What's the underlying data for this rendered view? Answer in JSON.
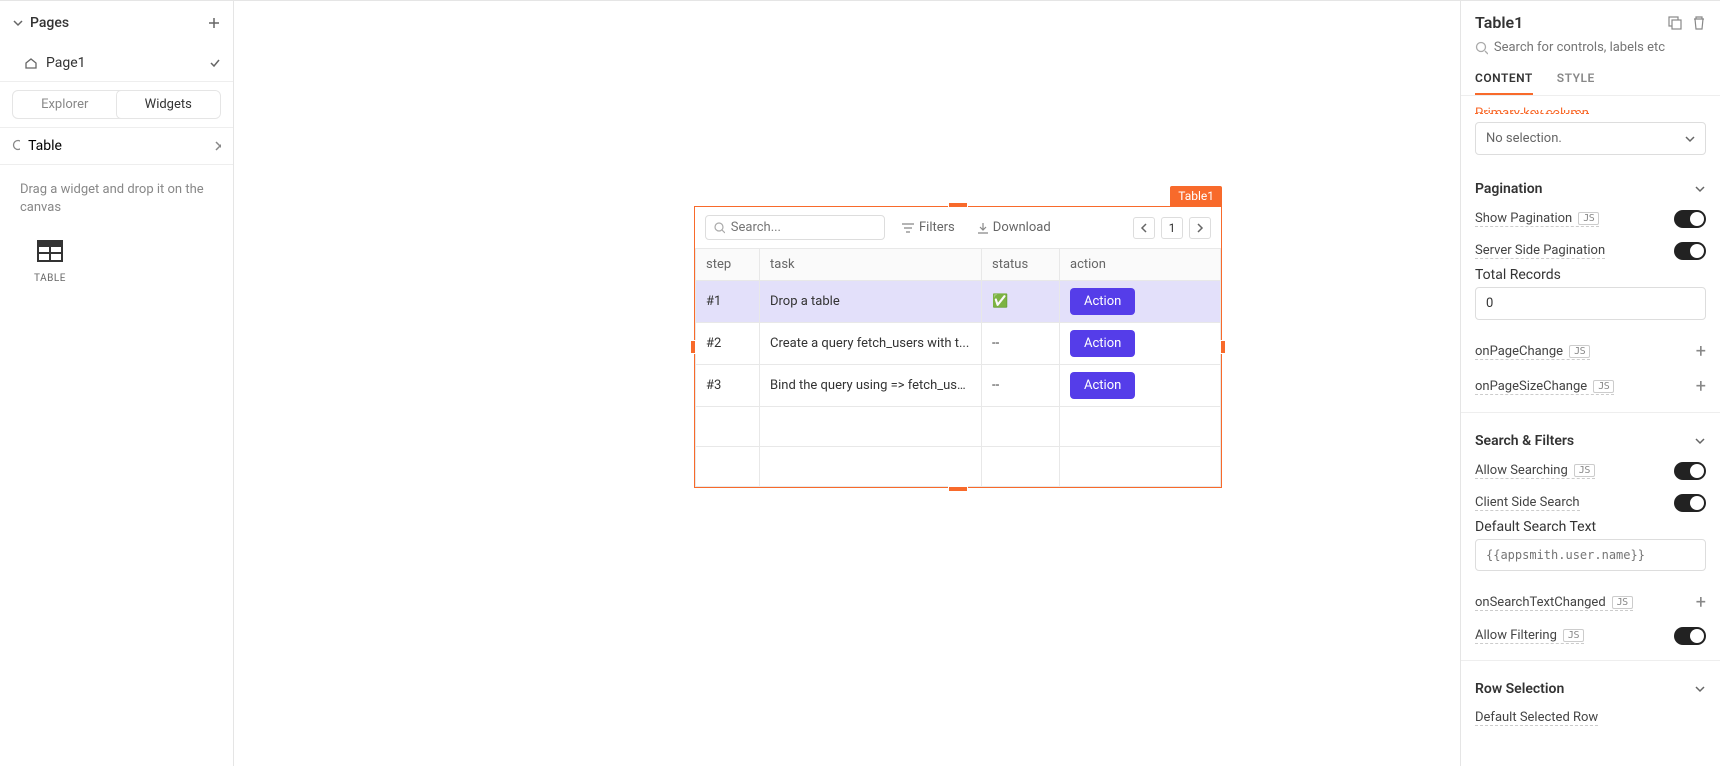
{
  "leftPanel": {
    "pagesLabel": "Pages",
    "pages": [
      "Page1"
    ],
    "segments": {
      "explorer": "Explorer",
      "widgets": "Widgets"
    },
    "searchValue": "Table",
    "hint": "Drag a widget and drop it on the canvas",
    "widgetTile": "TABLE"
  },
  "canvas": {
    "widgetName": "Table1",
    "toolbar": {
      "searchPlaceholder": "Search...",
      "filters": "Filters",
      "download": "Download",
      "page": "1"
    },
    "columns": [
      "step",
      "task",
      "status",
      "action"
    ],
    "colWidths": [
      "64px",
      "222px",
      "78px",
      "auto"
    ],
    "actionLabel": "Action",
    "emptyRows": 2,
    "rows": [
      {
        "step": "#1",
        "task": "Drop a table",
        "status": "✅",
        "selected": true
      },
      {
        "step": "#2",
        "task": "Create a query fetch_users with t...",
        "status": "--",
        "selected": false
      },
      {
        "step": "#3",
        "task": "Bind the query using => fetch_use...",
        "status": "--",
        "selected": false
      }
    ]
  },
  "rightPanel": {
    "title": "Table1",
    "searchPlaceholder": "Search for controls, labels etc",
    "tabs": {
      "content": "CONTENT",
      "style": "STYLE"
    },
    "primaryKeyCut": "Primary key column",
    "primaryKeyValue": "No selection.",
    "sections": {
      "pagination": {
        "title": "Pagination",
        "showPagination": "Show Pagination",
        "serverSide": "Server Side Pagination",
        "totalRecordsLabel": "Total Records",
        "totalRecordsValue": "0",
        "onPageChange": "onPageChange",
        "onPageSizeChange": "onPageSizeChange"
      },
      "searchFilters": {
        "title": "Search & Filters",
        "allowSearching": "Allow Searching",
        "clientSideSearch": "Client Side Search",
        "defaultSearchLabel": "Default Search Text",
        "defaultSearchPlaceholder": "{{appsmith.user.name}}",
        "onSearchTextChanged": "onSearchTextChanged",
        "allowFiltering": "Allow Filtering"
      },
      "rowSelection": {
        "title": "Row Selection",
        "defaultSelectedRow": "Default Selected Row"
      }
    },
    "jsBadge": "JS"
  }
}
